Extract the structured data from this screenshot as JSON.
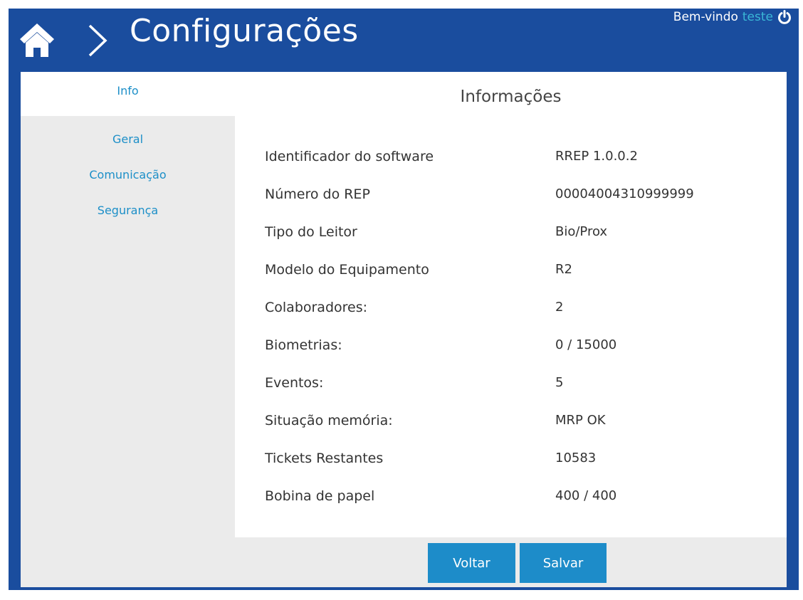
{
  "header": {
    "title": "Configurações",
    "welcome_label": "Bem-vindo",
    "username": "teste",
    "home_icon": "home-icon",
    "chevron_icon": "chevron-right-icon",
    "power_icon": "power-icon"
  },
  "sidebar": {
    "items": [
      {
        "label": "Info",
        "active": true
      },
      {
        "label": "Geral"
      },
      {
        "label": "Comunicação"
      },
      {
        "label": "Segurança"
      }
    ]
  },
  "panel": {
    "title": "Informações",
    "rows": [
      {
        "label": "Identificador do software",
        "value": "RREP 1.0.0.2"
      },
      {
        "label": "Número do REP",
        "value": "00004004310999999"
      },
      {
        "label": "Tipo do Leitor",
        "value": "Bio/Prox"
      },
      {
        "label": "Modelo do Equipamento",
        "value": "R2"
      },
      {
        "label": "Colaboradores:",
        "value": "2"
      },
      {
        "label": "Biometrias:",
        "value": "0 / 15000"
      },
      {
        "label": "Eventos:",
        "value": "5"
      },
      {
        "label": "Situação memória:",
        "value": "MRP OK"
      },
      {
        "label": "Tickets Restantes",
        "value": "10583"
      },
      {
        "label": "Bobina de papel",
        "value": "400 / 400"
      }
    ]
  },
  "buttons": {
    "back_label": "Voltar",
    "save_label": "Salvar"
  },
  "colors": {
    "frame": "#1a4d9e",
    "accent": "#1d8cc9",
    "link": "#1c8fc8",
    "username": "#3ab8d6",
    "content_bg": "#ebebeb"
  }
}
